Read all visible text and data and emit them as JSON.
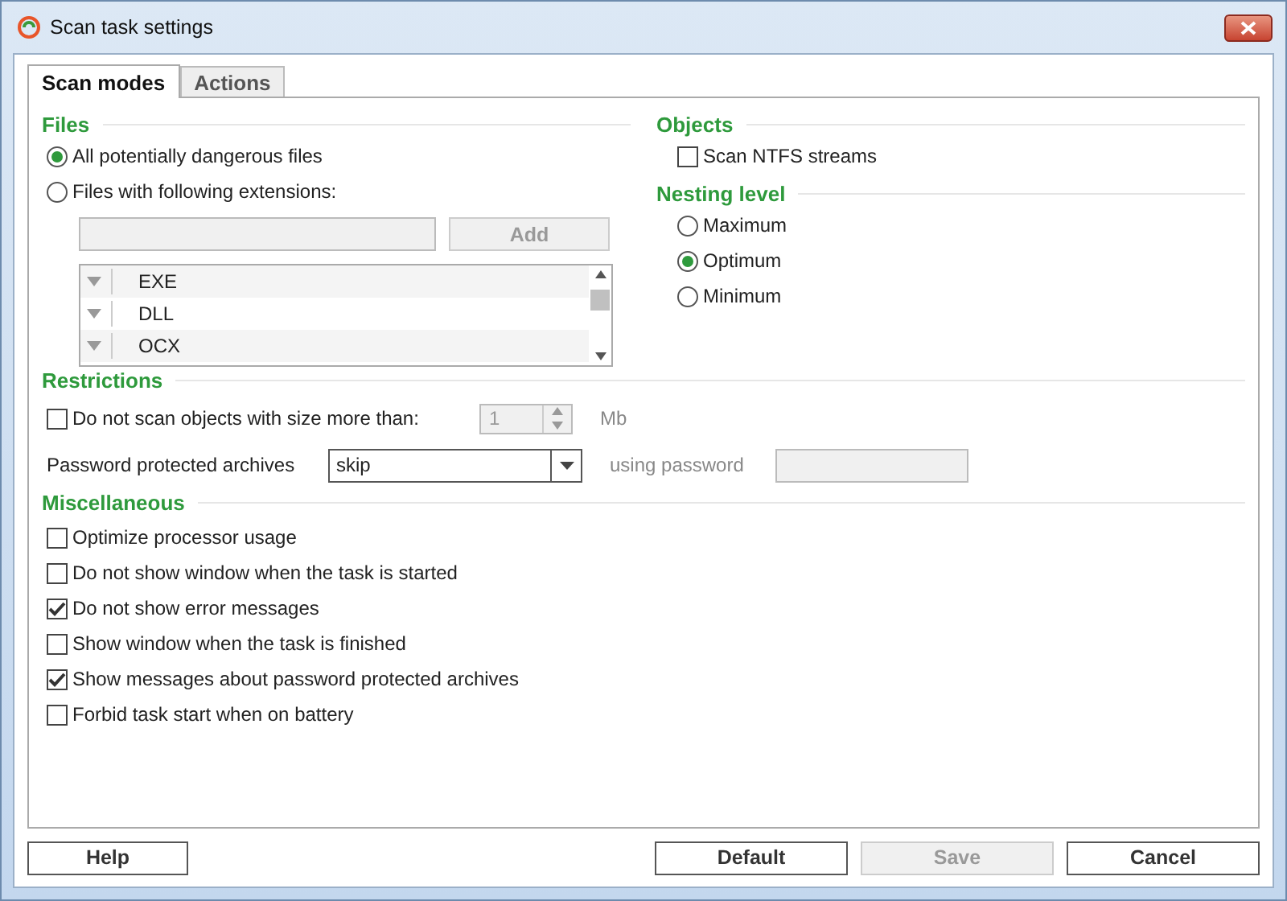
{
  "window": {
    "title": "Scan task settings"
  },
  "tabs": [
    {
      "label": "Scan modes",
      "selected": true
    },
    {
      "label": "Actions",
      "selected": false
    }
  ],
  "files": {
    "heading": "Files",
    "options": [
      {
        "label": "All potentially dangerous files",
        "selected": true
      },
      {
        "label": "Files with following extensions:",
        "selected": false
      }
    ],
    "extension_field": {
      "disabled": true
    },
    "add_button": {
      "label": "Add",
      "disabled": true
    },
    "extensions": [
      {
        "label": "EXE"
      },
      {
        "label": "DLL"
      },
      {
        "label": "OCX"
      }
    ]
  },
  "objects": {
    "heading": "Objects",
    "options": [
      {
        "label": "Scan NTFS streams",
        "checked": false
      }
    ]
  },
  "nesting_level": {
    "heading": "Nesting level",
    "options": [
      {
        "label": "Maximum",
        "selected": false
      },
      {
        "label": "Optimum",
        "selected": true
      },
      {
        "label": "Minimum",
        "selected": false
      }
    ]
  },
  "restrictions": {
    "heading": "Restrictions",
    "size_limit": {
      "label": "Do not scan objects with size more than:",
      "checked": false,
      "value": "1",
      "unit": "Mb",
      "disabled": true
    },
    "archives": {
      "label": "Password protected archives",
      "value": "skip",
      "password_label": "using password",
      "password_disabled": true
    }
  },
  "miscellaneous": {
    "heading": "Miscellaneous",
    "options": [
      {
        "label": "Optimize processor usage",
        "checked": false
      },
      {
        "label": "Do not show window when the task is started",
        "checked": false
      },
      {
        "label": "Do not show error messages",
        "checked": true
      },
      {
        "label": "Show window when the task is finished",
        "checked": false
      },
      {
        "label": "Show messages about password protected archives",
        "checked": true
      },
      {
        "label": "Forbid task start when on battery",
        "checked": false
      }
    ]
  },
  "buttons": [
    {
      "label": "Help",
      "disabled": false
    },
    {
      "label": "Default",
      "disabled": false
    },
    {
      "label": "Save",
      "disabled": true
    },
    {
      "label": "Cancel",
      "disabled": false
    }
  ]
}
